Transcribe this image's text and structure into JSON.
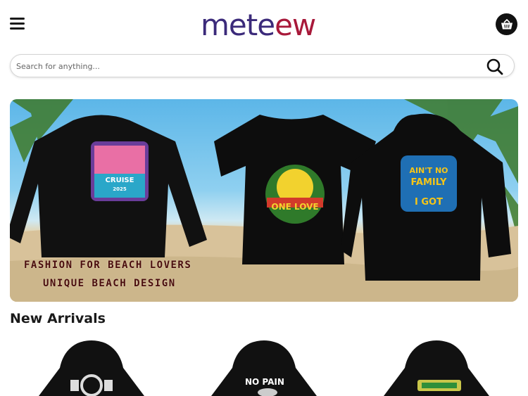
{
  "header": {
    "logo_part1": "mete",
    "logo_part2": "ew",
    "menu_icon": "hamburger-menu-icon",
    "cart_icon": "basket-icon"
  },
  "search": {
    "placeholder": "Search for anything...",
    "icon": "search-icon"
  },
  "banner": {
    "line1": "FASHION FOR BEACH LOVERS",
    "line2": "UNIQUE BEACH DESIGN",
    "shirt1_print": "FAMILY CRUISE 2025",
    "shirt2_print": "ONE LOVE",
    "shirt3_print": "AIN'T NO FAMILY LIKE THE ONE I GOT"
  },
  "new_arrivals": {
    "title": "New Arrivals",
    "products": [
      {
        "print": ""
      },
      {
        "print": "NO PAIN"
      },
      {
        "print": ""
      }
    ]
  },
  "colors": {
    "logo_purple": "#3b2a7a",
    "logo_red": "#a8193a",
    "banner_text": "#4a0d0d"
  }
}
